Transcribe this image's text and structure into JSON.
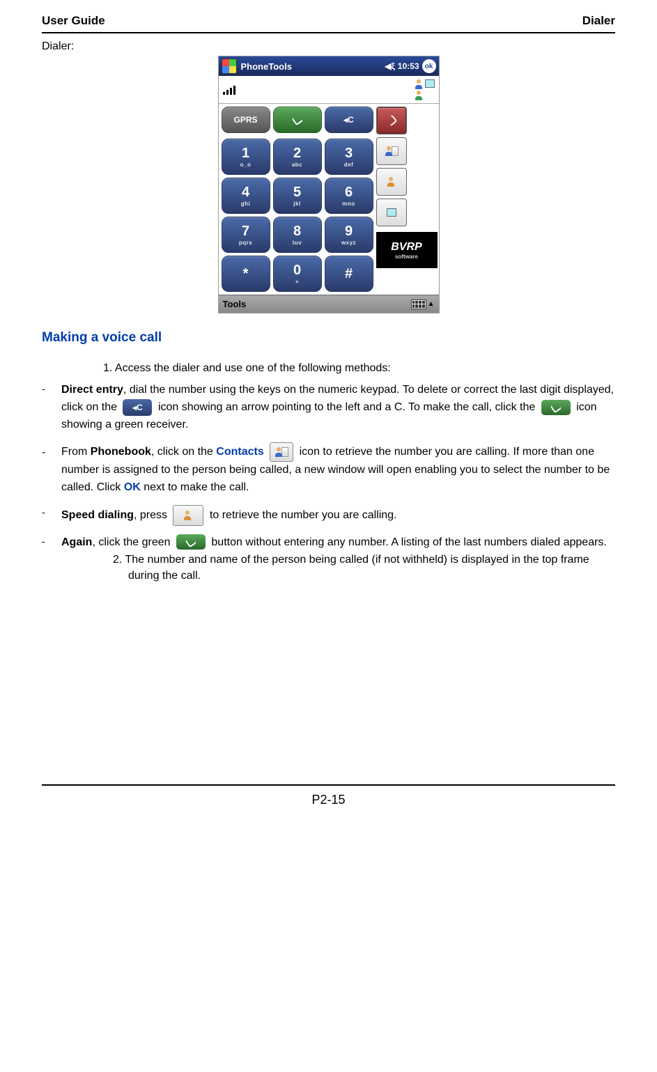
{
  "header": {
    "left": "User Guide",
    "right": "Dialer"
  },
  "dialer_label": "Dialer:",
  "pda": {
    "titlebar": {
      "title": "PhoneTools",
      "time": "10:53",
      "ok": "ok"
    },
    "keys": {
      "top": [
        {
          "big": "GPRS",
          "sub": "",
          "cls": "gray small"
        },
        {
          "big": "📞",
          "sub": "",
          "cls": "green small",
          "isCall": true
        },
        {
          "big": "◂C",
          "sub": "",
          "cls": " small"
        }
      ],
      "rows": [
        [
          {
            "big": "1",
            "sub": "o_o"
          },
          {
            "big": "2",
            "sub": "abc"
          },
          {
            "big": "3",
            "sub": "def"
          }
        ],
        [
          {
            "big": "4",
            "sub": "ghi"
          },
          {
            "big": "5",
            "sub": "jkl"
          },
          {
            "big": "6",
            "sub": "mno"
          }
        ],
        [
          {
            "big": "7",
            "sub": "pqrs"
          },
          {
            "big": "8",
            "sub": "tuv"
          },
          {
            "big": "9",
            "sub": "wxyz"
          }
        ],
        [
          {
            "big": "*",
            "sub": ""
          },
          {
            "big": "0",
            "sub": "+"
          },
          {
            "big": "#",
            "sub": ""
          }
        ]
      ]
    },
    "logo": {
      "name": "BVRP",
      "sub": "software"
    },
    "bottombar": {
      "left": "Tools"
    }
  },
  "section_title": "Making a voice call",
  "steps": {
    "s1": "1.   Access the dialer and use one of the following methods:",
    "s2": "2.   The number and name of the person being called (if not withheld) is displayed in the top frame during the call."
  },
  "bullets": {
    "direct": {
      "lead": "Direct entry",
      "p1": ", dial the number using the keys on the numeric keypad. To delete or correct the last digit displayed, click on the ",
      "p2": " icon showing an arrow pointing to the left and a C. To make the call, click the ",
      "p3": " icon showing a green receiver."
    },
    "phonebook": {
      "p1": "From ",
      "pb": "Phonebook",
      "p2": ", click on the ",
      "contacts": "Contacts",
      "p3": " icon to retrieve the number you are calling. If more than one number is assigned to the person being called, a new window will open enabling you to select the number to be called. Click ",
      "ok": "OK",
      "p4": " next to make the call."
    },
    "speed": {
      "lead": "Speed dialing",
      "p1": ", press ",
      "p2": " to retrieve the number you are calling."
    },
    "again": {
      "lead": "Again",
      "p1": ", click the green ",
      "p2": " button without entering any number. A listing of the last numbers dialed appears."
    }
  },
  "page_number": "P2-15"
}
